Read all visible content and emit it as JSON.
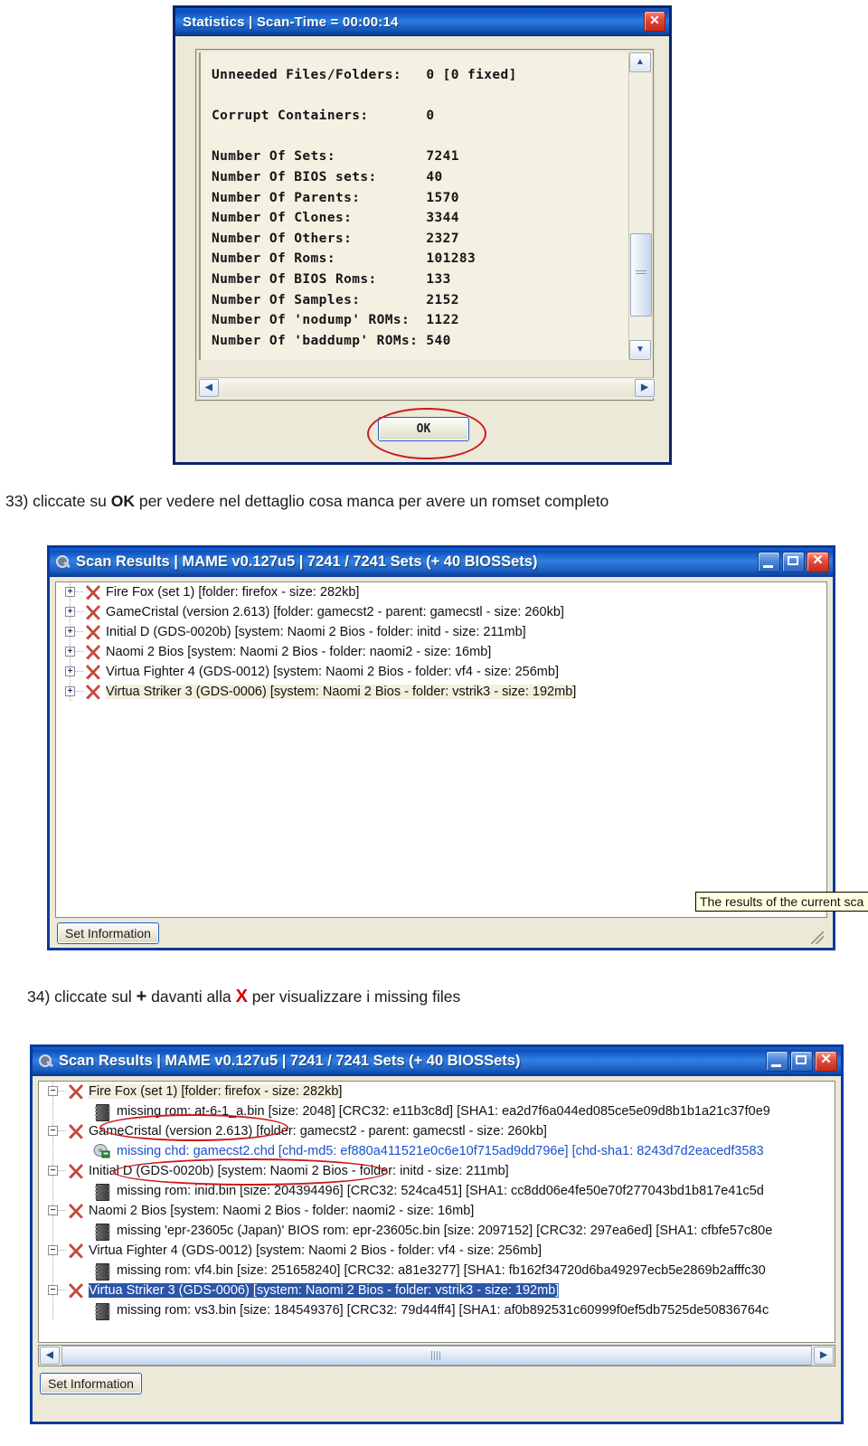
{
  "colors": {
    "xp_title_blue": "#0a3a9b",
    "window_face": "#ece9d8",
    "annotation_red": "#cc1b1b",
    "selection_blue": "#2a55a8",
    "link_blue": "#1a4fd0"
  },
  "statistics_dialog": {
    "title": "Statistics | Scan-Time = 00:00:14",
    "close_label": "✕",
    "report_lines": [
      "Unneeded Files/Folders:   0 [0 fixed]",
      "",
      "Corrupt Containers:       0",
      "",
      "Number Of Sets:           7241",
      "Number Of BIOS sets:      40",
      "Number Of Parents:        1570",
      "Number Of Clones:         3344",
      "Number Of Others:         2327",
      "Number Of Roms:           101283",
      "Number Of BIOS Roms:      133",
      "Number Of Samples:        2152",
      "Number Of 'nodump' ROMs:  1122",
      "Number Of 'baddump' ROMs: 540"
    ],
    "stats": {
      "unneeded_files_folders": "0 [0 fixed]",
      "corrupt_containers": "0",
      "number_of_sets": "7241",
      "number_of_bios_sets": "40",
      "number_of_parents": "1570",
      "number_of_clones": "3344",
      "number_of_others": "2327",
      "number_of_roms": "101283",
      "number_of_bios_roms": "133",
      "number_of_samples": "2152",
      "number_of_nodump_roms": "1122",
      "number_of_baddump_roms": "540"
    },
    "ok_label": "OK",
    "scroll_up": "▲",
    "scroll_down": "▼",
    "scroll_left": "◀",
    "scroll_right": "▶"
  },
  "captions": {
    "step33_pre": "33) cliccate su ",
    "step33_bold": "OK",
    "step33_post": " per vedere nel dettaglio cosa manca per avere un romset completo",
    "step34_pre": "34) cliccate sul ",
    "step34_plus": "+",
    "step34_mid": " davanti alla ",
    "step34_x": "X",
    "step34_post": " per visualizzare i missing files"
  },
  "scan_window_collapsed": {
    "title": "Scan Results  |  MAME v0.127u5  |  7241 / 7241 Sets (+ 40 BIOSSets)",
    "minimize_label": "",
    "maximize_label": "",
    "close_label": "✕",
    "rows": [
      {
        "expander": "+",
        "label": "Fire Fox (set 1) [folder: firefox - size: 282kb]",
        "selected": false
      },
      {
        "expander": "+",
        "label": "GameCristal (version 2.613) [folder: gamecst2 - parent: gamecstl - size: 260kb]",
        "selected": false
      },
      {
        "expander": "+",
        "label": "Initial D (GDS-0020b) [system: Naomi 2 Bios - folder: initd - size: 211mb]",
        "selected": false
      },
      {
        "expander": "+",
        "label": "Naomi 2 Bios [system: Naomi 2 Bios - folder: naomi2 - size: 16mb]",
        "selected": false
      },
      {
        "expander": "+",
        "label": "Virtua Fighter 4 (GDS-0012) [system: Naomi 2 Bios - folder: vf4 - size: 256mb]",
        "selected": false
      },
      {
        "expander": "+",
        "label": "Virtua Striker 3 (GDS-0006) [system: Naomi 2 Bios - folder: vstrik3 - size: 192mb]",
        "selected": true
      }
    ],
    "tooltip": "The results of the current sca",
    "set_information_label": "Set Information"
  },
  "scan_window_expanded": {
    "title": "Scan Results  |  MAME v0.127u5  |  7241 / 7241 Sets (+ 40 BIOSSets)",
    "close_label": "✕",
    "rows": [
      {
        "kind": "set",
        "expander": "−",
        "label": "Fire Fox (set 1) [folder: firefox - size: 282kb]",
        "highlight": "cream"
      },
      {
        "kind": "child",
        "icon": "chip-icon",
        "label": "missing rom: at-6-1_a.bin [size: 2048] [CRC32: e11b3c8d] [SHA1: ea2d7f6a044ed085ce5e09d8b1b1a21c37f0e9",
        "link": false
      },
      {
        "kind": "set",
        "expander": "−",
        "label": "GameCristal (version 2.613) [folder: gamecst2 - parent: gamecstl - size: 260kb]",
        "highlight": "none"
      },
      {
        "kind": "child",
        "icon": "chd-icon",
        "label": "missing chd: gamecst2.chd [chd-md5: ef880a411521e0c6e10f715ad9dd796e] [chd-sha1: 8243d7d2eacedf3583",
        "link": true
      },
      {
        "kind": "set",
        "expander": "−",
        "label": "Initial D (GDS-0020b) [system: Naomi 2 Bios - folder: initd - size: 211mb]",
        "highlight": "none"
      },
      {
        "kind": "child",
        "icon": "chip-icon",
        "label": "missing rom: inid.bin [size: 204394496] [CRC32: 524ca451] [SHA1: cc8dd06e4fe50e70f277043bd1b817e41c5d",
        "link": false
      },
      {
        "kind": "set",
        "expander": "−",
        "label": "Naomi 2 Bios [system: Naomi 2 Bios - folder: naomi2 - size: 16mb]",
        "highlight": "none"
      },
      {
        "kind": "child",
        "icon": "chip-icon",
        "label": "missing 'epr-23605c (Japan)' BIOS rom: epr-23605c.bin [size: 2097152] [CRC32: 297ea6ed] [SHA1: cfbfe57c80e",
        "link": false
      },
      {
        "kind": "set",
        "expander": "−",
        "label": "Virtua Fighter 4 (GDS-0012) [system: Naomi 2 Bios - folder: vf4 - size: 256mb]",
        "highlight": "none"
      },
      {
        "kind": "child",
        "icon": "chip-icon",
        "label": "missing rom: vf4.bin [size: 251658240] [CRC32: a81e3277] [SHA1: fb162f34720d6ba49297ecb5e2869b2afffc30",
        "link": false
      },
      {
        "kind": "set",
        "expander": "−",
        "label": "Virtua Striker 3 (GDS-0006) [system: Naomi 2 Bios - folder: vstrik3 - size: 192mb]",
        "highlight": "blue"
      },
      {
        "kind": "child",
        "icon": "chip-icon",
        "label": "missing rom: vs3.bin [size: 184549376] [CRC32: 79d44ff4] [SHA1: af0b892531c60999f0ef5db7525de50836764c",
        "link": false
      }
    ],
    "set_information_label": "Set Information",
    "scroll_left": "◀",
    "scroll_right": "▶"
  }
}
